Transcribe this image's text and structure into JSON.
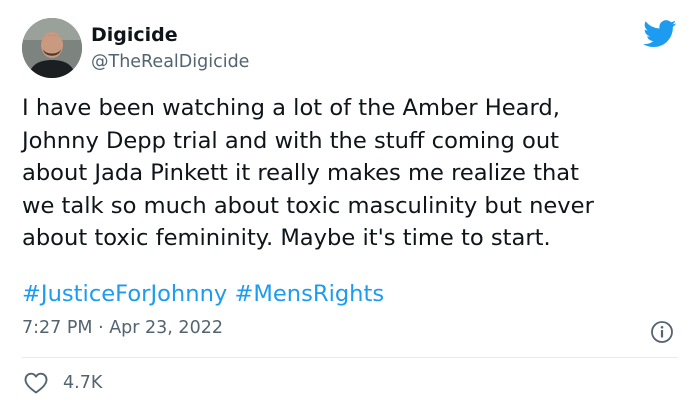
{
  "author": {
    "name": "Digicide",
    "handle": "@TheRealDigicide",
    "avatar_icon": "profile-photo"
  },
  "tweet": {
    "lines": [
      "I have been watching a lot of the Amber Heard,",
      "Johnny Depp trial and with the stuff coming out",
      "about Jada Pinkett it really makes me realize that",
      "we talk so much about toxic masculinity but never",
      "about toxic femininity. Maybe it's time to start."
    ],
    "hashtags": [
      "#JusticeForJohnny",
      "#MensRights"
    ],
    "timestamp": "7:27 PM · Apr 23, 2022"
  },
  "actions": {
    "like_count": "4.7K",
    "like_icon": "heart-icon",
    "info_icon": "info-icon"
  },
  "icons": {
    "brand": "twitter-bird-icon"
  },
  "colors": {
    "brand_blue": "#1d9bf0",
    "text_primary": "#0f1419",
    "text_secondary": "#536471",
    "divider": "#e6ecf0"
  }
}
